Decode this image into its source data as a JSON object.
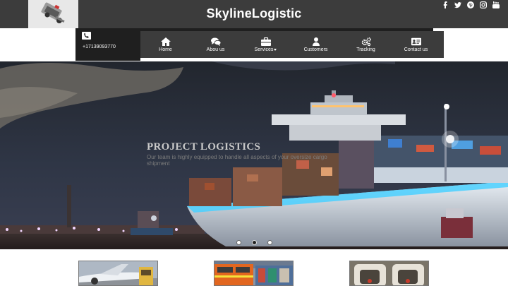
{
  "brand": {
    "name": "SkylineLogistic",
    "logo_icon": "truck-loader-logo"
  },
  "social": [
    "facebook-icon",
    "twitter-icon",
    "pinterest-icon",
    "instagram-icon",
    "youtube-icon"
  ],
  "contact": {
    "phone": "+17139093770",
    "icon": "phone-icon"
  },
  "nav": {
    "items": [
      {
        "label": "Home",
        "icon": "home-icon"
      },
      {
        "label": "Abou us",
        "icon": "comments-icon"
      },
      {
        "label": "Services",
        "icon": "briefcase-icon",
        "has_dropdown": true
      },
      {
        "label": "Customers",
        "icon": "user-icon"
      },
      {
        "label": "Tracking",
        "icon": "gears-icon"
      },
      {
        "label": "Contact us",
        "icon": "id-card-icon"
      }
    ]
  },
  "hero": {
    "title": "PROJECT LOGISTICS",
    "subtitle": "Our team is highly equipped to handle all aspects of your oversize cargo shipment",
    "slides": 3,
    "active_slide": 2
  },
  "thumbnails": [
    "airplane-cargo-image",
    "train-containers-image",
    "cargo-crates-image"
  ],
  "colors": {
    "topbar": "#3c3c3c",
    "nav_dark": "#1f1f1f",
    "text": "#ffffff"
  }
}
